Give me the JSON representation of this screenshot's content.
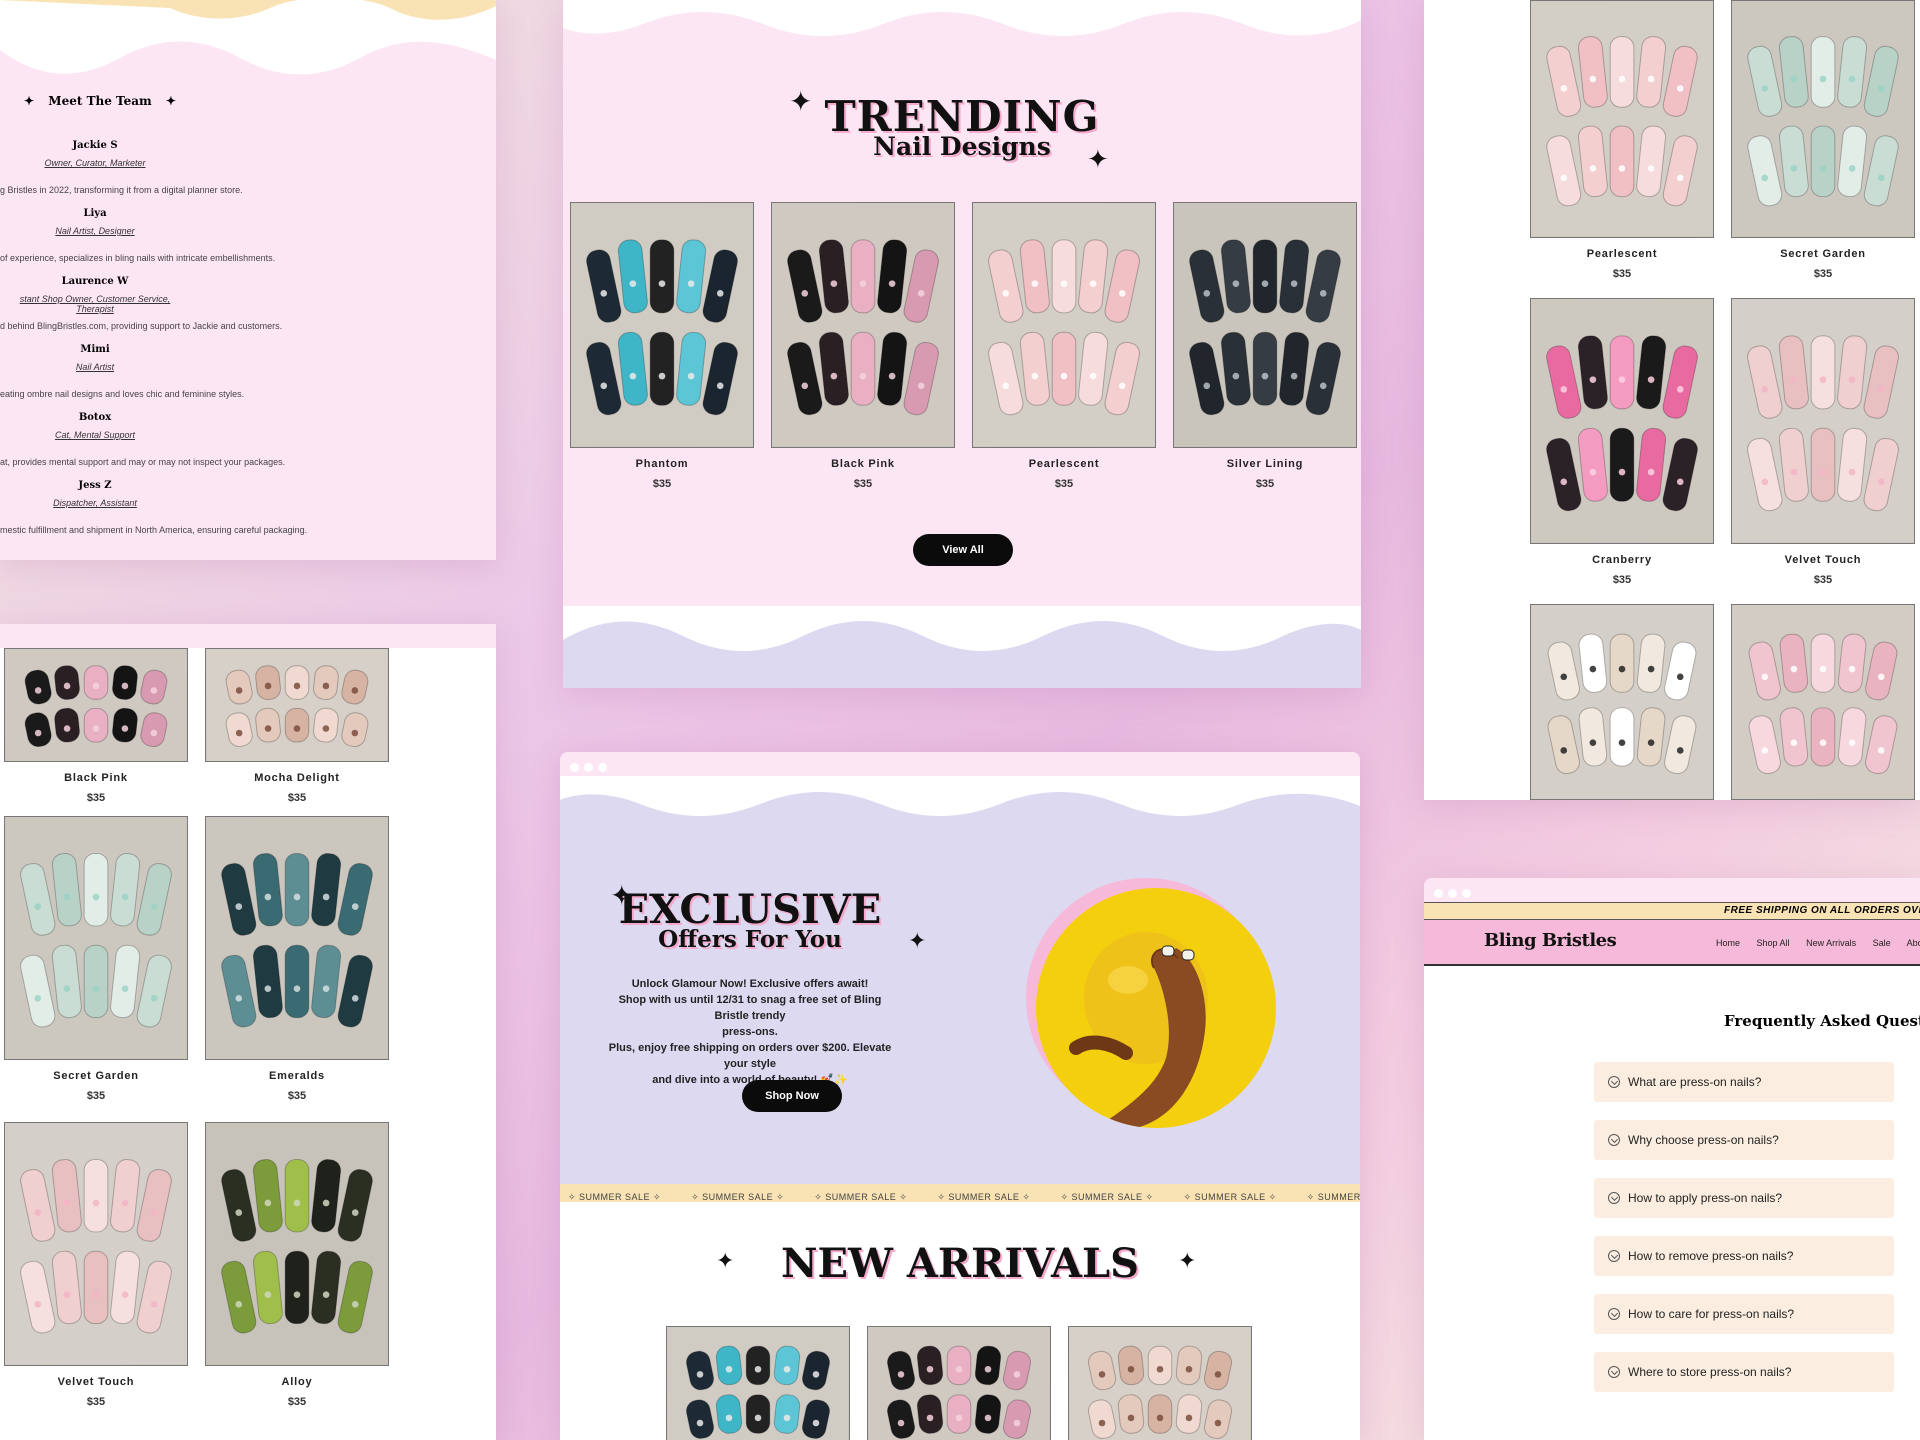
{
  "team": {
    "title": "Meet The Team",
    "members": [
      {
        "name": "Jackie S",
        "role": "Owner, Curator, Marketer",
        "bio": "g Bristles in 2022, transforming it from a digital planner store."
      },
      {
        "name": "Liya",
        "role": "Nail Artist, Designer",
        "bio": "of experience, specializes in bling nails with intricate embellishments."
      },
      {
        "name": "Laurence W",
        "role": "stant Shop Owner, Customer Service, Therapist",
        "bio": "d behind BlingBristles.com, providing support to Jackie and customers."
      },
      {
        "name": "Mimi",
        "role": "Nail Artist",
        "bio": "eating ombre nail designs and loves chic and feminine styles."
      },
      {
        "name": "Botox",
        "role": "Cat, Mental Support",
        "bio": "at, provides mental support and may or may not inspect your packages."
      },
      {
        "name": "Jess Z",
        "role": "Dispatcher, Assistant",
        "bio": "mestic fulfillment and shipment in North America, ensuring careful packaging."
      }
    ]
  },
  "trending": {
    "title_main": "TRENDING",
    "title_sub": "Nail Designs",
    "products": [
      {
        "name": "Phantom",
        "price": "$35",
        "palette": "teal"
      },
      {
        "name": "Black Pink",
        "price": "$35",
        "palette": "blackpink"
      },
      {
        "name": "Pearlescent",
        "price": "$35",
        "palette": "pink"
      },
      {
        "name": "Silver Lining",
        "price": "$35",
        "palette": "dark"
      }
    ],
    "view_all": "View All"
  },
  "grid_left": {
    "products": [
      {
        "name": "Black Pink",
        "price": "$35",
        "palette": "blackpink"
      },
      {
        "name": "Mocha Delight",
        "price": "$35",
        "palette": "mocha"
      },
      {
        "name": "Secret Garden",
        "price": "$35",
        "palette": "mint"
      },
      {
        "name": "Emeralds",
        "price": "$35",
        "palette": "emerald"
      },
      {
        "name": "Velvet Touch",
        "price": "$35",
        "palette": "nude"
      },
      {
        "name": "Alloy",
        "price": "$35",
        "palette": "olive"
      }
    ]
  },
  "grid_right": {
    "products": [
      {
        "name": "Pearlescent",
        "price": "$35",
        "palette": "pink"
      },
      {
        "name": "Secret Garden",
        "price": "$35",
        "palette": "mint"
      },
      {
        "name": "Cranberry",
        "price": "$35",
        "palette": "cranberry"
      },
      {
        "name": "Velvet Touch",
        "price": "$35",
        "palette": "nude"
      },
      {
        "name": "",
        "price": "",
        "palette": "chanel"
      },
      {
        "name": "",
        "price": "",
        "palette": "kitty"
      }
    ]
  },
  "offers": {
    "title_main": "EXCLUSIVE",
    "title_sub": "Offers For You",
    "lines": [
      "Unlock Glamour Now! Exclusive offers await!",
      "Shop with us until 12/31 to snag a free set of Bling Bristle trendy",
      "press-ons.",
      "Plus, enjoy free shipping on orders over $200. Elevate your style",
      "and dive into a world of beauty! 💅✨"
    ],
    "shop_now": "Shop Now",
    "marquee": [
      "✧ SUMMER SALE ✧",
      "✧ SUMMER SALE ✧",
      "✧ SUMMER SALE ✧",
      "✧ SUMMER SALE ✧",
      "✧ SUMMER SALE ✧",
      "✧ SUMMER SALE ✧",
      "✧ SUMMER SALE ✧",
      "✧ SUMMER"
    ],
    "new_arrivals": "NEW ARRIVALS",
    "arrivals": [
      {
        "palette": "teal"
      },
      {
        "palette": "blackpink"
      },
      {
        "palette": "mocha"
      }
    ]
  },
  "faq": {
    "banner": "FREE SHIPPING ON ALL ORDERS OVER $20",
    "brand": "Bling Bristles",
    "nav": [
      "Home",
      "Shop All",
      "New Arrivals",
      "Sale",
      "Abou"
    ],
    "title": "Frequently Asked Question",
    "questions": [
      "What are press-on nails?",
      "Why choose press-on nails?",
      "How to apply press-on nails?",
      "How to remove press-on nails?",
      "How to care for press-on nails?",
      "Where to store press-on nails?"
    ]
  },
  "colors": {
    "pink_bg": "#fde6f4",
    "lavender": "#dcd9f1",
    "cream": "#f9e3b4",
    "nav_pink": "#f7b9d9",
    "black": "#0b0b0b"
  }
}
